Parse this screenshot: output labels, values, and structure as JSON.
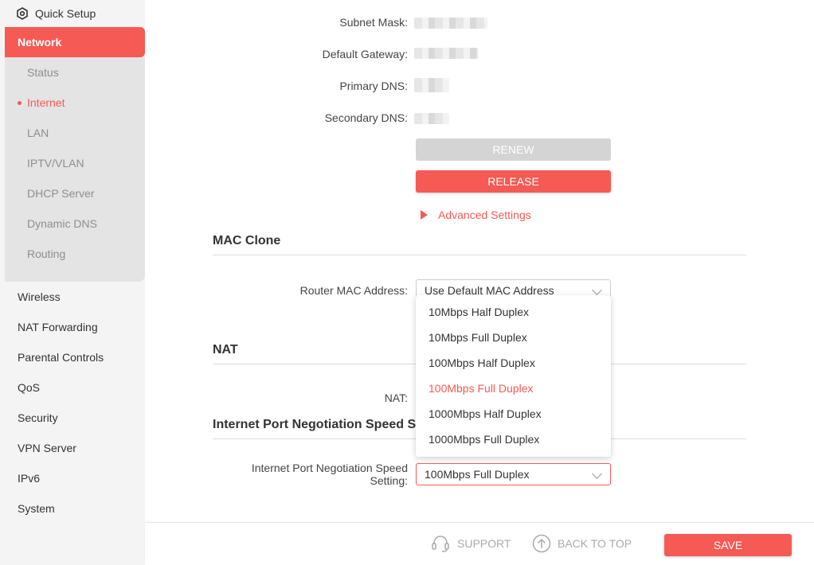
{
  "sidebar": {
    "quick_setup": "Quick Setup",
    "network": "Network",
    "network_sub": [
      "Status",
      "Internet",
      "LAN",
      "IPTV/VLAN",
      "DHCP Server",
      "Dynamic DNS",
      "Routing"
    ],
    "active_sub": "Internet",
    "items": [
      "Wireless",
      "NAT Forwarding",
      "Parental Controls",
      "QoS",
      "Security",
      "VPN Server",
      "IPv6",
      "System"
    ]
  },
  "ip_info": {
    "subnet_mask_label": "Subnet Mask:",
    "default_gateway_label": "Default Gateway:",
    "primary_dns_label": "Primary DNS:",
    "secondary_dns_label": "Secondary DNS:"
  },
  "buttons": {
    "renew": "RENEW",
    "release": "RELEASE"
  },
  "advanced_settings": "Advanced Settings",
  "mac_clone": {
    "title": "MAC Clone",
    "label": "Router MAC Address:",
    "value": "Use Default MAC Address"
  },
  "nat": {
    "title": "NAT",
    "label": "NAT:"
  },
  "port_speed": {
    "title": "Internet Port Negotiation Speed S",
    "label_line1": "Internet Port Negotiation Speed",
    "label_line2": "Setting:",
    "value": "100Mbps Full Duplex",
    "options": [
      "10Mbps Half Duplex",
      "10Mbps Full Duplex",
      "100Mbps Half Duplex",
      "100Mbps Full Duplex",
      "1000Mbps Half Duplex",
      "1000Mbps Full Duplex"
    ],
    "selected": "100Mbps Full Duplex"
  },
  "footer": {
    "support": "SUPPORT",
    "back_to_top": "BACK TO TOP",
    "save": "SAVE"
  },
  "colors": {
    "accent": "#f55a55",
    "sidebar_bg": "#f4f4f4",
    "subnav_bg": "#e4e4e4",
    "disabled_button": "#d4d4d4"
  }
}
